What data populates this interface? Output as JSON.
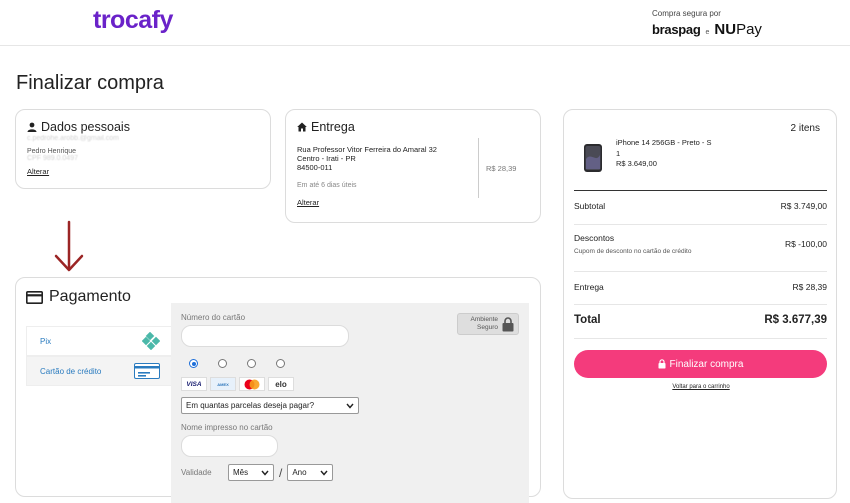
{
  "header": {
    "logo": "trocafy",
    "secure_text": "Compra segura por",
    "brand_braspag": "braspag",
    "brand_sep": "e",
    "brand_nupay_nu": "NU",
    "brand_nupay_pay": "Pay"
  },
  "page_title": "Finalizar compra",
  "dados": {
    "title": "Dados pessoais",
    "email": "c.pedrohe.arobb.@gmail.com",
    "name": "Pedro Henrique",
    "cpf": "CPF 989.0.0497",
    "change": "Alterar"
  },
  "entrega": {
    "title": "Entrega",
    "street": "Rua Professor Vitor Ferreira do Amaral 32",
    "district": "Centro - Irati - PR",
    "zip": "84500-011",
    "eta": "Em até 6 dias úteis",
    "price": "R$ 28,39",
    "change": "Alterar"
  },
  "pagamento": {
    "title": "Pagamento",
    "methods": [
      {
        "label": "Pix"
      },
      {
        "label": "Cartão de crédito"
      }
    ],
    "card_number_label": "Número do cartão",
    "ambiente_line1": "Ambiente",
    "ambiente_line2": "Seguro",
    "brands": [
      "VISA",
      "AMEX",
      "MC",
      "elo"
    ],
    "installments_placeholder": "Em quantas parcelas deseja pagar?",
    "name_label": "Nome impresso no cartão",
    "validity_label": "Validade",
    "month_placeholder": "Mês",
    "year_placeholder": "Ano",
    "slash": "/"
  },
  "resumo": {
    "items_count": "2 itens",
    "product_name": "iPhone 14 256GB - Preto - S",
    "product_qty": "1",
    "product_price": "R$ 3.649,00",
    "subtotal_label": "Subtotal",
    "subtotal_value": "R$ 3.749,00",
    "descontos_label": "Descontos",
    "descontos_sub": "Cupom de desconto no cartão de crédito",
    "descontos_value": "R$ -100,00",
    "entrega_label": "Entrega",
    "entrega_value": "R$ 28,39",
    "total_label": "Total",
    "total_value": "R$ 3.677,39",
    "finalize_label": "Finalizar compra",
    "back_label": "Voltar para o carrinho"
  },
  "colors": {
    "brand_purple": "#6a22c9",
    "cta_pink": "#f43b7c",
    "arrow_red": "#9b2525",
    "link_blue": "#2a7bbf"
  }
}
